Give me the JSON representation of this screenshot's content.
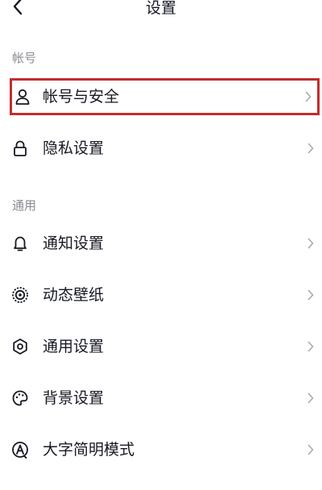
{
  "nav": {
    "title": "设置",
    "back_icon": "chevron-left-icon"
  },
  "sections": {
    "account": {
      "header": "帐号",
      "items": [
        {
          "label": "帐号与安全",
          "icon": "user-icon",
          "highlighted": true
        },
        {
          "label": "隐私设置",
          "icon": "lock-icon"
        }
      ]
    },
    "general": {
      "header": "通用",
      "items": [
        {
          "label": "通知设置",
          "icon": "bell-icon"
        },
        {
          "label": "动态壁纸",
          "icon": "live-wallpaper-icon"
        },
        {
          "label": "通用设置",
          "icon": "gear-icon"
        },
        {
          "label": "背景设置",
          "icon": "palette-icon"
        },
        {
          "label": "大字简明模式",
          "icon": "large-text-mode-icon"
        }
      ]
    }
  },
  "colors": {
    "text": "#161823",
    "secondary_text": "#8a8b91",
    "highlight_border": "#c22d2d",
    "chevron": "#a8a9ad",
    "background": "#ffffff"
  }
}
